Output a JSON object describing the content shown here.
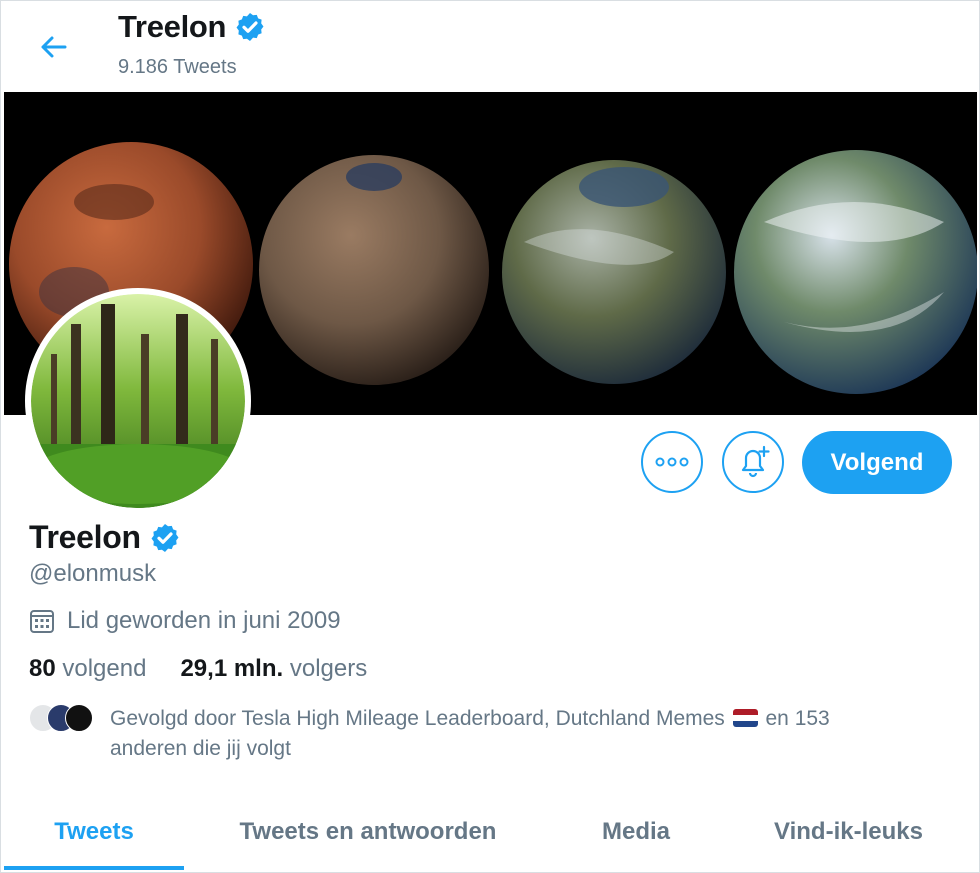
{
  "header": {
    "back_icon": "arrow-left-icon",
    "name": "Treelon",
    "verified_icon": "verified-badge-icon",
    "tweet_count": "9.186 Tweets"
  },
  "banner": {
    "description_icon": "terraforming-planets-banner"
  },
  "avatar": {
    "icon": "forest-avatar"
  },
  "actions": {
    "more_icon": "more-dots-icon",
    "bell_icon": "notification-bell-plus-icon",
    "follow_label": "Volgend"
  },
  "profile": {
    "name": "Treelon",
    "handle": "@elonmusk",
    "joined": "Lid geworden in juni 2009",
    "following_count": "80",
    "following_label": "volgend",
    "followers_count": "29,1 mln.",
    "followers_label": "volgers",
    "followed_by_prefix": "Gevolgd door Tesla High Mileage Leaderboard, Dutchland Memes",
    "followed_by_suffix": "en 153 anderen die jij volgt"
  },
  "colors": {
    "accent": "#1da1f2",
    "muted": "#657786",
    "text": "#14171a"
  },
  "tabs": [
    {
      "label": "Tweets",
      "active": true
    },
    {
      "label": "Tweets en antwoorden",
      "active": false
    },
    {
      "label": "Media",
      "active": false
    },
    {
      "label": "Vind-ik-leuks",
      "active": false
    }
  ]
}
